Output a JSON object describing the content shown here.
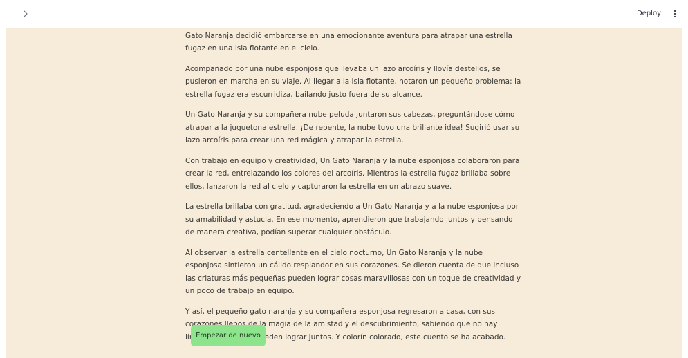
{
  "header": {
    "deploy_label": "Deploy",
    "sidebar_toggle_icon": "chevron-right-icon",
    "menu_icon": "kebab-menu-icon"
  },
  "story": {
    "paragraphs": [
      "muy cercanos que amistaban como pequeños cuidantes en el cielo nocturno. Un día, Un Gato Naranja decidió embarcarse en una emocionante aventura para atrapar una estrella fugaz en una isla flotante en el cielo.",
      "Acompañado por una nube esponjosa que llevaba un lazo arcoíris y llovía destellos, se pusieron en marcha en su viaje. Al llegar a la isla flotante, notaron un pequeño problema: la estrella fugaz era escurridiza, bailando justo fuera de su alcance.",
      "Un Gato Naranja y su compañera nube peluda juntaron sus cabezas, preguntándose cómo atrapar a la juguetona estrella. ¡De repente, la nube tuvo una brillante idea! Sugirió usar su lazo arcoíris para crear una red mágica y atrapar la estrella.",
      "Con trabajo en equipo y creatividad, Un Gato Naranja y la nube esponjosa colaboraron para crear la red, entrelazando los colores del arcoíris. Mientras la estrella fugaz brillaba sobre ellos, lanzaron la red al cielo y capturaron la estrella en un abrazo suave.",
      "La estrella brillaba con gratitud, agradeciendo a Un Gato Naranja y a la nube esponjosa por su amabilidad y astucia. En ese momento, aprendieron que trabajando juntos y pensando de manera creativa, podían superar cualquier obstáculo.",
      "Al observar la estrella centellante en el cielo nocturno, Un Gato Naranja y la nube esponjosa sintieron un cálido resplandor en sus corazones. Se dieron cuenta de que incluso las criaturas más pequeñas pueden lograr cosas maravillosas con un toque de creatividad y un poco de trabajo en equipo.",
      "Y así, el pequeño gato naranja y su compañera esponjosa regresaron a casa, con sus corazones llenos de la magia de la amistad y el descubrimiento, sabiendo que no hay límites para lo que pueden lograr juntos. Y colorín colorado, este cuento se ha acabado."
    ]
  },
  "actions": {
    "restart_label": "Empezar de nuevo"
  },
  "colors": {
    "panel_background": "#f7ecd9",
    "button_background": "#8ee48c",
    "text": "#3b3a36"
  }
}
